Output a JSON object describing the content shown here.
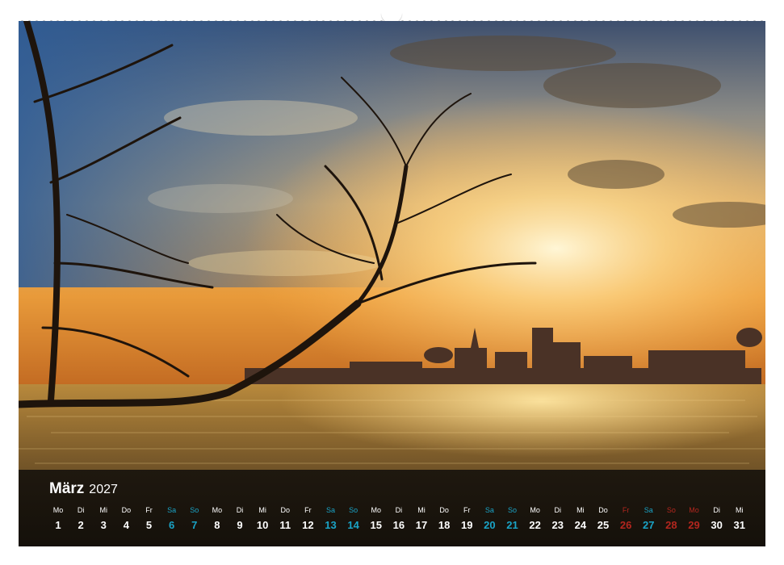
{
  "calendar": {
    "month": "März",
    "year": "2027",
    "days": [
      {
        "wd": "Mo",
        "n": "1",
        "kind": "weekday"
      },
      {
        "wd": "Di",
        "n": "2",
        "kind": "weekday"
      },
      {
        "wd": "Mi",
        "n": "3",
        "kind": "weekday"
      },
      {
        "wd": "Do",
        "n": "4",
        "kind": "weekday"
      },
      {
        "wd": "Fr",
        "n": "5",
        "kind": "weekday"
      },
      {
        "wd": "Sa",
        "n": "6",
        "kind": "weekend"
      },
      {
        "wd": "So",
        "n": "7",
        "kind": "weekend"
      },
      {
        "wd": "Mo",
        "n": "8",
        "kind": "weekday"
      },
      {
        "wd": "Di",
        "n": "9",
        "kind": "weekday"
      },
      {
        "wd": "Mi",
        "n": "10",
        "kind": "weekday"
      },
      {
        "wd": "Do",
        "n": "11",
        "kind": "weekday"
      },
      {
        "wd": "Fr",
        "n": "12",
        "kind": "weekday"
      },
      {
        "wd": "Sa",
        "n": "13",
        "kind": "weekend"
      },
      {
        "wd": "So",
        "n": "14",
        "kind": "weekend"
      },
      {
        "wd": "Mo",
        "n": "15",
        "kind": "weekday"
      },
      {
        "wd": "Di",
        "n": "16",
        "kind": "weekday"
      },
      {
        "wd": "Mi",
        "n": "17",
        "kind": "weekday"
      },
      {
        "wd": "Do",
        "n": "18",
        "kind": "weekday"
      },
      {
        "wd": "Fr",
        "n": "19",
        "kind": "weekday"
      },
      {
        "wd": "Sa",
        "n": "20",
        "kind": "weekend"
      },
      {
        "wd": "So",
        "n": "21",
        "kind": "weekend"
      },
      {
        "wd": "Mo",
        "n": "22",
        "kind": "weekday"
      },
      {
        "wd": "Di",
        "n": "23",
        "kind": "weekday"
      },
      {
        "wd": "Mi",
        "n": "24",
        "kind": "weekday"
      },
      {
        "wd": "Do",
        "n": "25",
        "kind": "weekday"
      },
      {
        "wd": "Fr",
        "n": "26",
        "kind": "holiday"
      },
      {
        "wd": "Sa",
        "n": "27",
        "kind": "weekend"
      },
      {
        "wd": "So",
        "n": "28",
        "kind": "holiday"
      },
      {
        "wd": "Mo",
        "n": "29",
        "kind": "holiday"
      },
      {
        "wd": "Di",
        "n": "30",
        "kind": "weekday"
      },
      {
        "wd": "Mi",
        "n": "31",
        "kind": "weekday"
      }
    ]
  },
  "colors": {
    "weekday": "#ffffff",
    "weekend": "#1aa3c6",
    "holiday": "#b3261e"
  }
}
